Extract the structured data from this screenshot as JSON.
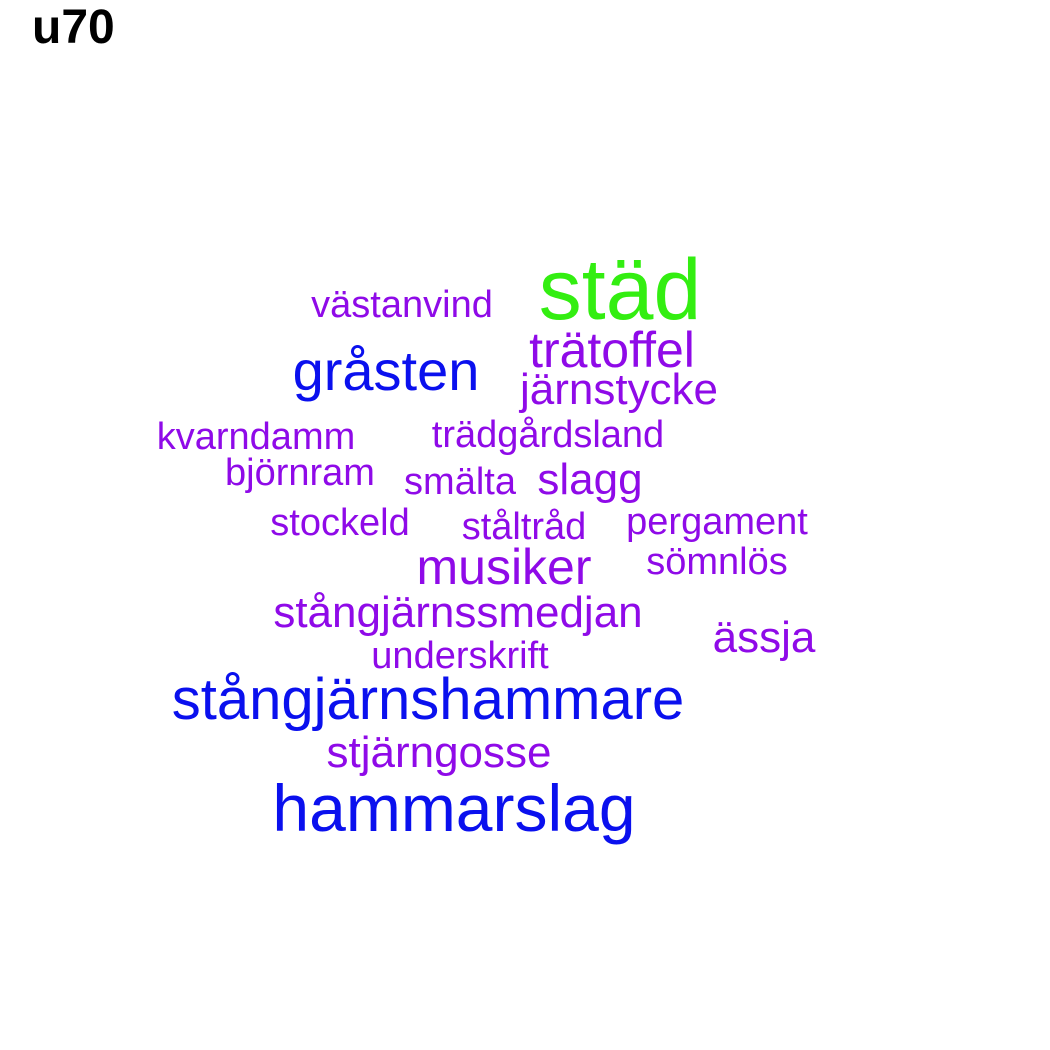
{
  "title": "u70",
  "colors": {
    "green": "#33ee11",
    "blue": "#0a10ee",
    "purple": "#8f0ae8"
  },
  "words": [
    {
      "text": "städ",
      "color": "green"
    },
    {
      "text": "västanvind",
      "color": "purple"
    },
    {
      "text": "trätoffel",
      "color": "purple"
    },
    {
      "text": "gråsten",
      "color": "blue"
    },
    {
      "text": "järnstycke",
      "color": "purple"
    },
    {
      "text": "kvarndamm",
      "color": "purple"
    },
    {
      "text": "trädgårdsland",
      "color": "purple"
    },
    {
      "text": "björnram",
      "color": "purple"
    },
    {
      "text": "smälta",
      "color": "purple"
    },
    {
      "text": "slagg",
      "color": "purple"
    },
    {
      "text": "stockeld",
      "color": "purple"
    },
    {
      "text": "ståltråd",
      "color": "purple"
    },
    {
      "text": "pergament",
      "color": "purple"
    },
    {
      "text": "musiker",
      "color": "purple"
    },
    {
      "text": "sömnlös",
      "color": "purple"
    },
    {
      "text": "stångjärnssmedjan",
      "color": "purple"
    },
    {
      "text": "ässja",
      "color": "purple"
    },
    {
      "text": "underskrift",
      "color": "purple"
    },
    {
      "text": "stångjärnshammare",
      "color": "blue"
    },
    {
      "text": "stjärngosse",
      "color": "purple"
    },
    {
      "text": "hammarslag",
      "color": "blue"
    }
  ]
}
